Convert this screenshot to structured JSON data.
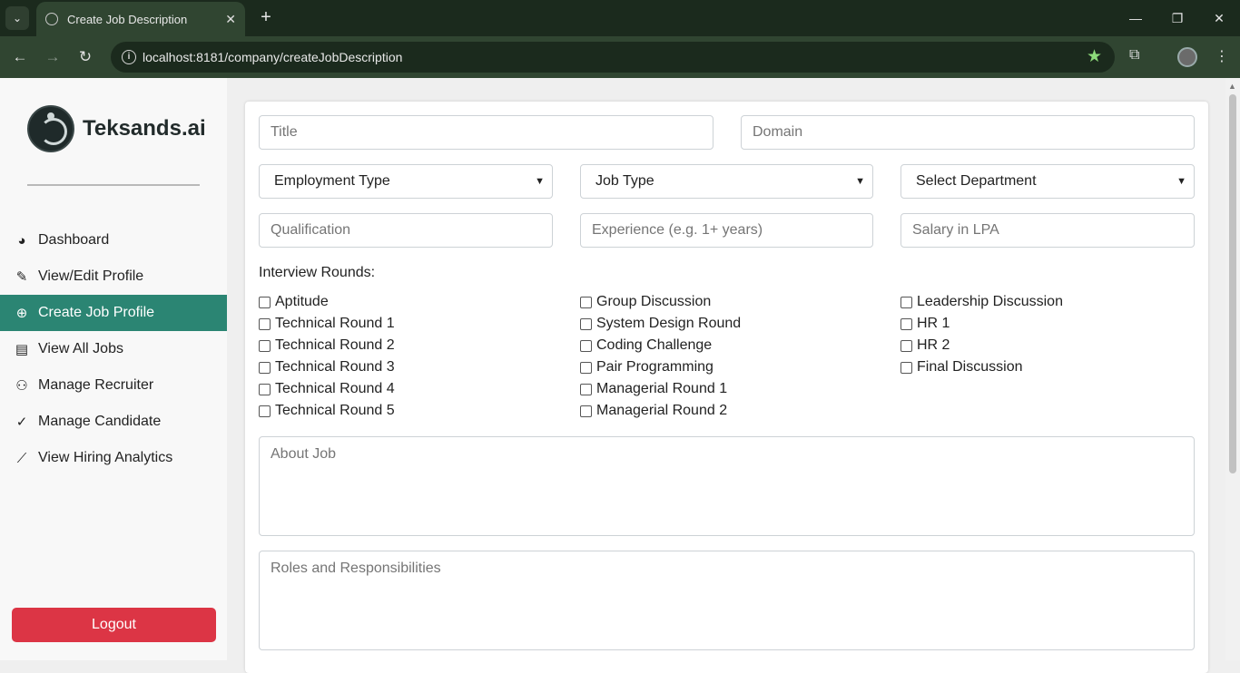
{
  "browser": {
    "tab_title": "Create Job Description",
    "url": "localhost:8181/company/createJobDescription",
    "accent_color": "#8ddc7a"
  },
  "sidebar": {
    "brand": "Teksands.ai",
    "items": [
      {
        "label": "Dashboard",
        "icon": "palette-icon"
      },
      {
        "label": "View/Edit Profile",
        "icon": "user-edit-icon"
      },
      {
        "label": "Create Job Profile",
        "icon": "plus-circle-icon",
        "active": true
      },
      {
        "label": "View All Jobs",
        "icon": "briefcase-icon"
      },
      {
        "label": "Manage Recruiter",
        "icon": "users-icon"
      },
      {
        "label": "Manage Candidate",
        "icon": "user-check-icon"
      },
      {
        "label": "View Hiring Analytics",
        "icon": "chart-line-icon"
      }
    ],
    "logout_label": "Logout",
    "active_color": "#2b8573",
    "logout_color": "#dc3545"
  },
  "form": {
    "title_placeholder": "Title",
    "domain_placeholder": "Domain",
    "employment_type": "Employment Type",
    "job_type": "Job Type",
    "department": "Select Department",
    "qualification_placeholder": "Qualification",
    "experience_placeholder": "Experience (e.g. 1+ years)",
    "salary_placeholder": "Salary in LPA",
    "interview_rounds_label": "Interview Rounds:",
    "rounds_col1": [
      "Aptitude",
      "Technical Round 1",
      "Technical Round 2",
      "Technical Round 3",
      "Technical Round 4",
      "Technical Round 5"
    ],
    "rounds_col2": [
      "Group Discussion",
      "System Design Round",
      "Coding Challenge",
      "Pair Programming",
      "Managerial Round 1",
      "Managerial Round 2"
    ],
    "rounds_col3": [
      "Leadership Discussion",
      "HR 1",
      "HR 2",
      "Final Discussion"
    ],
    "about_job_placeholder": "About Job",
    "roles_placeholder": "Roles and Responsibilities"
  }
}
